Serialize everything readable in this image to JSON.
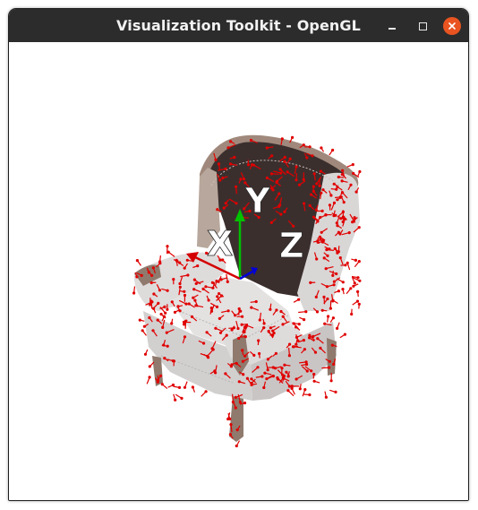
{
  "window": {
    "title": "Visualization Toolkit - OpenGL"
  },
  "controls": {
    "minimize": "minimize-icon",
    "maximize": "maximize-icon",
    "close": "close-icon"
  },
  "axes": {
    "x_label": "X",
    "y_label": "Y",
    "z_label": "Z",
    "x_color": "#d40000",
    "y_color": "#00c000",
    "z_color": "#0000d8"
  },
  "colors": {
    "titlebar": "#2c2c2c",
    "close_button": "#e95420",
    "normal_arrows": "#e00000",
    "chair_fabric": "#d9d6d6",
    "chair_back": "#3b2f2e",
    "chair_wood": "#a0897c"
  }
}
